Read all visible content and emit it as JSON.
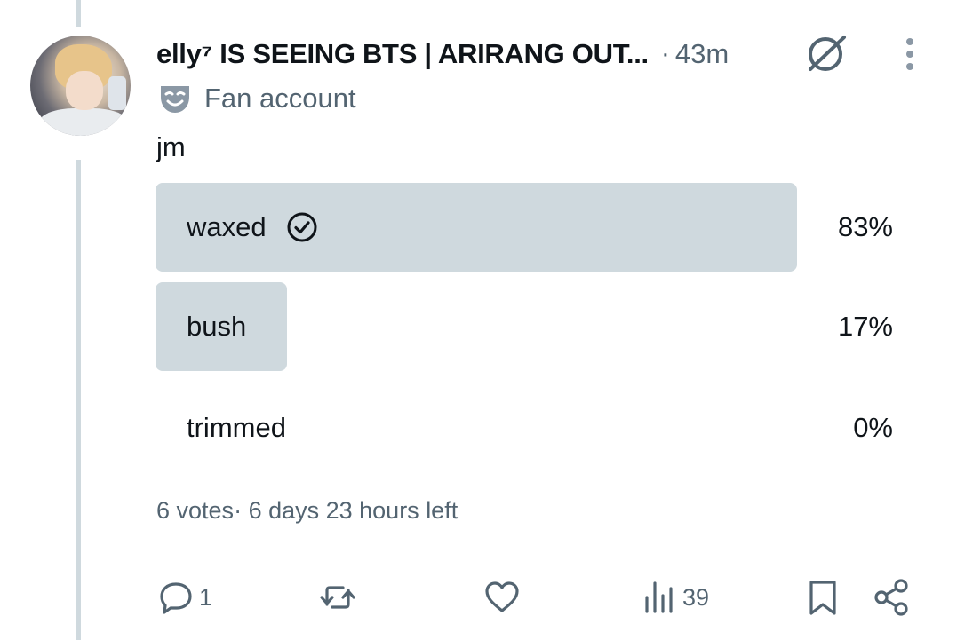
{
  "post": {
    "display_name": "elly⁷ IS SEEING BTS | ARIRANG OUT...",
    "separator": "·",
    "timestamp": "43m",
    "label": "Fan account",
    "text": "jm"
  },
  "poll": {
    "options": [
      {
        "label": "waxed",
        "percent": "83%",
        "value": 83,
        "selected": true
      },
      {
        "label": "bush",
        "percent": "17%",
        "value": 17,
        "selected": false
      },
      {
        "label": "trimmed",
        "percent": "0%",
        "value": 0,
        "selected": false
      }
    ],
    "votes": "6 votes",
    "time_left": "6 days 23 hours left"
  },
  "actions": {
    "replies": "1",
    "reposts": "",
    "likes": "",
    "views": "39"
  },
  "icons": {
    "grok": "grok-icon",
    "more": "more-icon",
    "label": "fan-account-mask-icon",
    "check": "check-circle-icon",
    "reply": "reply-icon",
    "repost": "repost-icon",
    "like": "heart-icon",
    "views": "views-icon",
    "bookmark": "bookmark-icon",
    "share": "share-icon"
  },
  "colors": {
    "text": "#0f1419",
    "secondary": "#536471",
    "poll_bar": "#cfd9de",
    "thread_line": "#cfd9de"
  }
}
